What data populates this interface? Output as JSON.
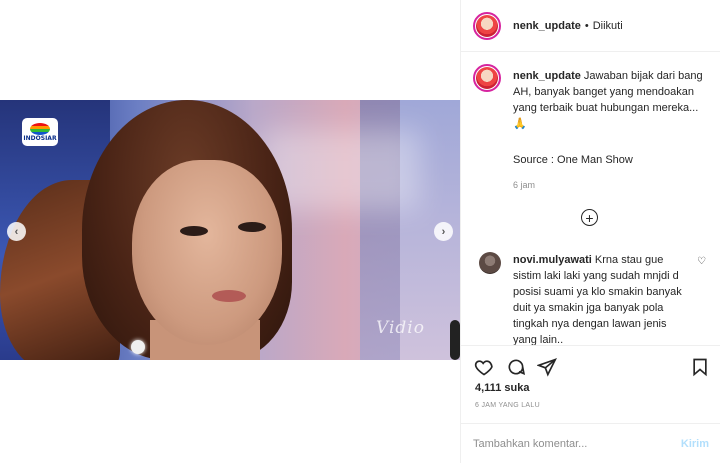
{
  "post": {
    "username": "nenk_update",
    "follow_separator": "•",
    "follow_status": "Diikuti",
    "caption_text": "Jawaban bijak dari bang AH, banyak banget yang mendoakan yang terbaik buat hubungan mereka... 🙏",
    "caption_source": "Source : One Man Show",
    "caption_time": "6 jam",
    "load_more_icon": "⊕",
    "likes": "4,111 suka",
    "posted_ago": "6 JAM YANG LALU"
  },
  "media": {
    "channel_logo_text": "INDOSIAR",
    "watermark": "Vidio",
    "prev_icon": "‹",
    "next_icon": "›"
  },
  "comments": [
    {
      "username": "novi.mulyawati",
      "text": "Krna stau gue sistim laki laki yang sudah mnjdi d posisi suami ya klo smakin banyak duit ya smakin jga banyak pola tingkah nya dengan lawan jenis yang lain..",
      "like_icon": "♡"
    }
  ],
  "comment_input": {
    "placeholder": "Tambahkan komentar...",
    "post_label": "Kirim"
  },
  "icons": {
    "like": "heart-icon",
    "comment": "comment-icon",
    "share": "share-icon",
    "save": "bookmark-icon"
  },
  "colors": {
    "accent_ring": "#d6249f",
    "post_button_disabled": "#b2dffc",
    "muted_text": "#8e8e8e"
  }
}
